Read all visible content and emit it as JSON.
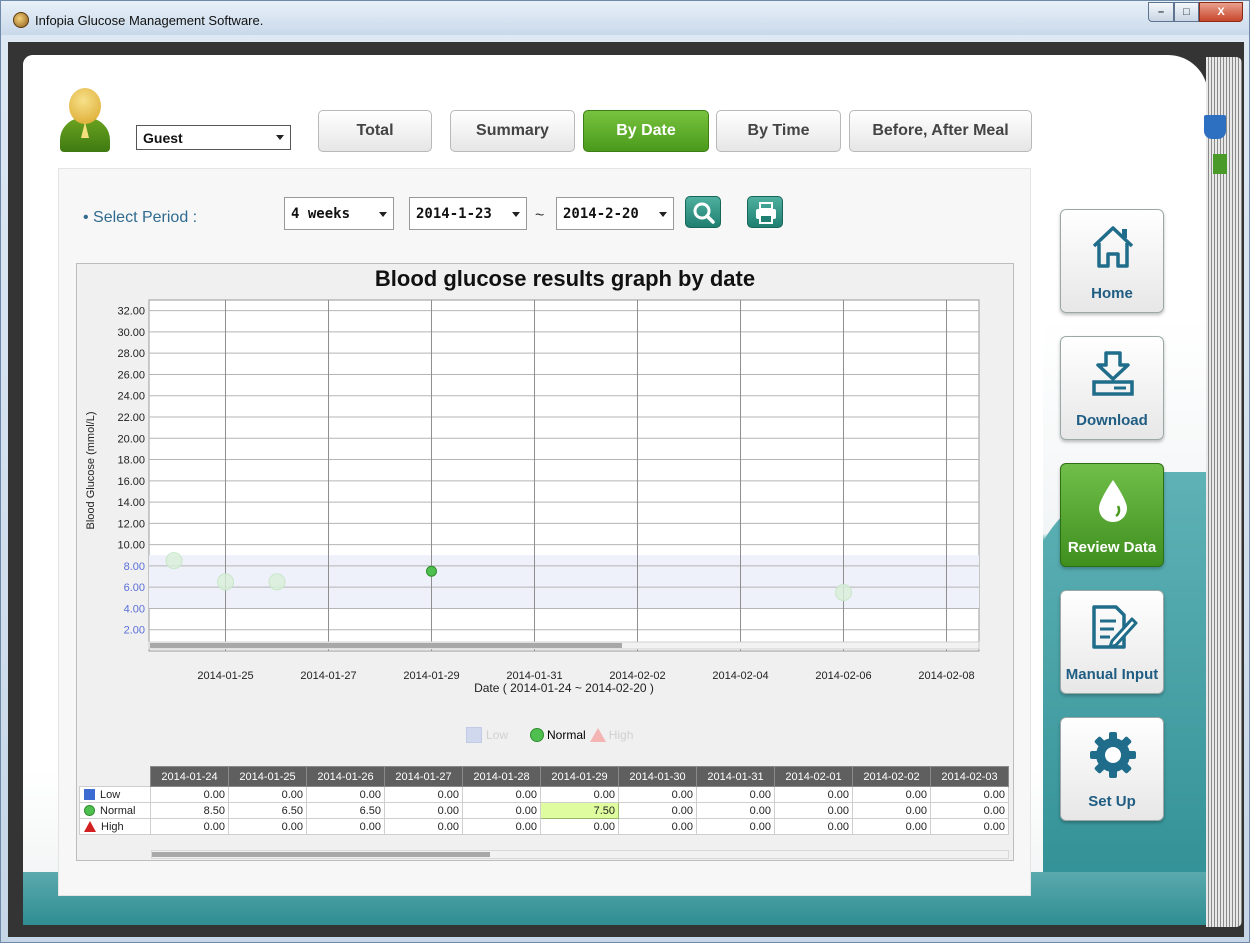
{
  "window": {
    "title": "Infopia Glucose Management Software.",
    "controls": {
      "minimize": "–",
      "maximize": "□",
      "close": "X"
    }
  },
  "user": {
    "name": "Guest"
  },
  "tabs": [
    {
      "label": "Total",
      "active": false
    },
    {
      "label": "Summary",
      "active": false
    },
    {
      "label": "By Date",
      "active": true
    },
    {
      "label": "By Time",
      "active": false
    },
    {
      "label": "Before, After Meal",
      "active": false
    }
  ],
  "period": {
    "label": "• Select Period :",
    "range": "4 weeks",
    "start": "2014-1-23",
    "end": "2014-2-20",
    "separator": "~"
  },
  "chart_data": {
    "type": "scatter",
    "title": "Blood glucose results graph by date",
    "ylabel": "Blood Glucose (mmol/L)",
    "xlabel": "Date ( 2014-01-24 ~ 2014-02-20 )",
    "ylim": [
      0,
      33
    ],
    "yticks": [
      "32.00",
      "30.00",
      "28.00",
      "26.00",
      "24.00",
      "22.00",
      "20.00",
      "18.00",
      "16.00",
      "14.00",
      "12.00",
      "10.00",
      "8.00",
      "6.00",
      "4.00",
      "2.00"
    ],
    "xticks": [
      "2014-01-25",
      "2014-01-27",
      "2014-01-29",
      "2014-01-31",
      "2014-02-02",
      "2014-02-04",
      "2014-02-06",
      "2014-02-08"
    ],
    "normal_band": [
      4,
      9
    ],
    "series": [
      {
        "name": "Normal",
        "points": [
          {
            "x": "2014-01-24",
            "y": 8.5,
            "dim": true
          },
          {
            "x": "2014-01-25",
            "y": 6.5,
            "dim": true
          },
          {
            "x": "2014-01-26",
            "y": 6.5,
            "dim": true
          },
          {
            "x": "2014-01-29",
            "y": 7.5,
            "dim": false
          },
          {
            "x": "2014-02-06",
            "y": 5.5,
            "dim": true
          }
        ]
      }
    ],
    "legend": [
      "Low",
      "Normal",
      "High"
    ],
    "colors": {
      "normal": "#4fbf4f",
      "low": "#3c6bd2",
      "high": "#d21f1f",
      "band": "#eef0fa"
    }
  },
  "table": {
    "dates": [
      "2014-01-24",
      "2014-01-25",
      "2014-01-26",
      "2014-01-27",
      "2014-01-28",
      "2014-01-29",
      "2014-01-30",
      "2014-01-31",
      "2014-02-01",
      "2014-02-02",
      "2014-02-03"
    ],
    "rows": [
      {
        "label": "Low",
        "values": [
          "0.00",
          "0.00",
          "0.00",
          "0.00",
          "0.00",
          "0.00",
          "0.00",
          "0.00",
          "0.00",
          "0.00",
          "0.00"
        ]
      },
      {
        "label": "Normal",
        "values": [
          "8.50",
          "6.50",
          "6.50",
          "0.00",
          "0.00",
          "7.50",
          "0.00",
          "0.00",
          "0.00",
          "0.00",
          "0.00"
        ]
      },
      {
        "label": "High",
        "values": [
          "0.00",
          "0.00",
          "0.00",
          "0.00",
          "0.00",
          "0.00",
          "0.00",
          "0.00",
          "0.00",
          "0.00",
          "0.00"
        ]
      }
    ]
  },
  "sidebar": [
    {
      "label": "Home",
      "icon": "home-icon"
    },
    {
      "label": "Download",
      "icon": "download-icon"
    },
    {
      "label": "Review Data",
      "icon": "drop-icon",
      "active": true
    },
    {
      "label": "Manual Input",
      "icon": "edit-icon"
    },
    {
      "label": "Set Up",
      "icon": "gear-icon"
    }
  ]
}
